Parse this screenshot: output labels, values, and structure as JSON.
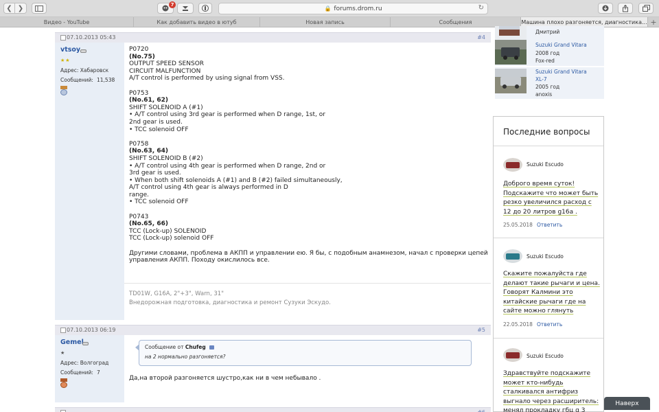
{
  "browser": {
    "url": "forums.drom.ru",
    "badge_count": "7",
    "tabs": [
      {
        "label": "Видео - YouTube"
      },
      {
        "label": "Как добавить видео в ютуб"
      },
      {
        "label": "Новая запись"
      },
      {
        "label": "Сообщения"
      },
      {
        "label": "Машина плохо разгоняется, диагностика..."
      }
    ],
    "new_tab": "+"
  },
  "posts": [
    {
      "date": "07.10.2013 05:43",
      "number": "#4",
      "author": "vtsoy",
      "stars": "★★",
      "address": "Адрес: Хабаровск",
      "messages_label": "Сообщений:",
      "messages_count": "11,538",
      "lines": {
        "p1_code": "P0720",
        "p1_no": "(No.75)",
        "p1_l1": "OUTPUT SPEED SENSOR",
        "p1_l2": "CIRCUIT MALFUNCTION",
        "p1_l3": "A/T control is performed by using signal from VSS.",
        "p2_code": "P0753",
        "p2_no": "(No.61, 62)",
        "p2_l1": "SHIFT SOLENOID A (#1)",
        "p2_l2": "• A/T control using 3rd gear is performed when D range, 1st, or",
        "p2_l3": "2nd gear is used.",
        "p2_l4": "• TCC solenoid OFF",
        "p3_code": "P0758",
        "p3_no": "(No.63, 64)",
        "p3_l1": "SHIFT SOLENOID B (#2)",
        "p3_l2": "• A/T control using 4th gear is performed when D range, 2nd or",
        "p3_l3": "3rd gear is used.",
        "p3_l4": "• When both shift solenoids A (#1) and B (#2) failed simultaneously,",
        "p3_l5": "A/T control using 4th gear is always performed in D",
        "p3_l6": "range.",
        "p3_l7": "• TCC solenoid OFF",
        "p4_code": "P0743",
        "p4_no": "(No.65, 66)",
        "p4_l1": "TCC (Lock-up) SOLENOID",
        "p4_l2": "TCC (Lock-up) solenoid OFF",
        "p5_l1": "Другими словами, проблема в АКПП и управлении ею. Я бы, с подобным анамнезом, начал с проверки цепей",
        "p5_l2": "управления АКПП. Походу окислилось все."
      },
      "signature_l1": "TD01W, G16A, 2\"+3\", Warn, 31\"",
      "signature_l2": "Внедорожная подготовка, диагностика и ремонт Сузуки Эскудо."
    },
    {
      "date": "07.10.2013 06:19",
      "number": "#5",
      "author": "Gemel",
      "stars": "★",
      "address": "Адрес: Волгоград",
      "messages_label": "Сообщений:",
      "messages_count": "7",
      "quote_from_label": "Сообщение от",
      "quote_author": "Chufeg",
      "quote_text": "на 2 нормально разгоняется?",
      "text": "Да,на второй разгоняется шустро,как ни в чем небывало ."
    },
    {
      "number": "#6"
    }
  ],
  "sidebar": {
    "cars": [
      {
        "owner": "Дмитрий"
      },
      {
        "name": "Suzuki Grand Vitara",
        "year": "2008 год",
        "owner": "Fox-red"
      },
      {
        "name": "Suzuki Grand Vitara",
        "name2": "XL-7",
        "year": "2005 год",
        "owner": "anoxis"
      }
    ],
    "questions_title": "Последние вопросы",
    "questions": [
      {
        "car": "Suzuki Escudo",
        "lines": [
          "Доброго время суток!",
          "Подскажите что может быть",
          "резко увеличился расход с",
          "12 до 20 литров g16a ."
        ],
        "date": "25.05.2018",
        "reply": "Ответить"
      },
      {
        "car": "Suzuki Escudo",
        "lines": [
          "Скажите пожалуйста где",
          "делают такие рычаги и цена.",
          "Говорят Калмини это",
          "китайские рычаги где на",
          "сайте можно глянуть"
        ],
        "date": "22.05.2018",
        "reply": "Ответить"
      },
      {
        "car": "Suzuki Escudo",
        "lines": [
          "Здравствуйте подскажите",
          "может кто-нибудь",
          "сталкивался антифриз",
          "выгнало через расширитель:",
          "менял прокладку гбц g 3"
        ]
      }
    ]
  },
  "back_to_top": "Наверх"
}
